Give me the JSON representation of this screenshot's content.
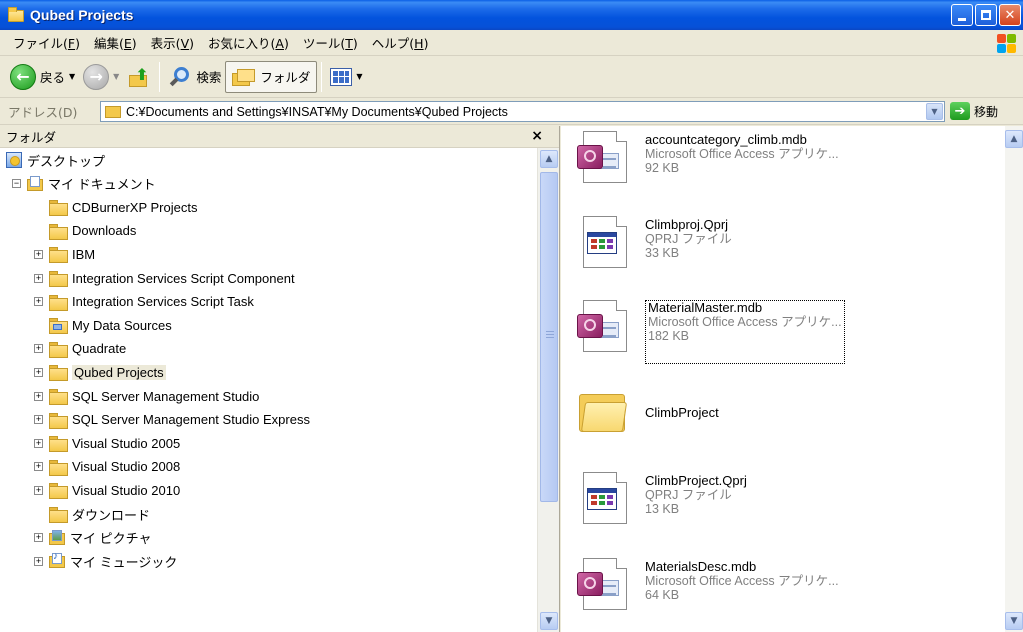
{
  "window": {
    "title": "Qubed Projects"
  },
  "menu": [
    {
      "text": "ファイル(",
      "key": "F",
      "end": ")"
    },
    {
      "text": "編集(",
      "key": "E",
      "end": ")"
    },
    {
      "text": "表示(",
      "key": "V",
      "end": ")"
    },
    {
      "text": "お気に入り(",
      "key": "A",
      "end": ")"
    },
    {
      "text": "ツール(",
      "key": "T",
      "end": ")"
    },
    {
      "text": "ヘルプ(",
      "key": "H",
      "end": ")"
    }
  ],
  "toolbar": {
    "back": "戻る",
    "search": "検索",
    "folders": "フォルダ"
  },
  "address": {
    "label": "アドレス(D)",
    "path": "C:¥Documents and Settings¥INSAT¥My Documents¥Qubed Projects",
    "go": "移動"
  },
  "folder_pane": {
    "title": "フォルダ",
    "close": "×",
    "tree": [
      {
        "label": "デスクトップ",
        "icon": "desktop-icon",
        "level": 0,
        "expander": ""
      },
      {
        "label": "マイ ドキュメント",
        "icon": "my-documents-icon",
        "level": 1,
        "expander": "−"
      },
      {
        "label": "CDBurnerXP Projects",
        "icon": "folder-icon",
        "level": 2,
        "expander": ""
      },
      {
        "label": "Downloads",
        "icon": "folder-icon",
        "level": 2,
        "expander": ""
      },
      {
        "label": "IBM",
        "icon": "folder-icon",
        "level": 2,
        "expander": "+"
      },
      {
        "label": "Integration Services Script Component",
        "icon": "folder-icon",
        "level": 2,
        "expander": "+"
      },
      {
        "label": "Integration Services Script Task",
        "icon": "folder-icon",
        "level": 2,
        "expander": "+"
      },
      {
        "label": "My Data Sources",
        "icon": "data-sources-icon",
        "level": 2,
        "expander": ""
      },
      {
        "label": "Quadrate",
        "icon": "folder-icon",
        "level": 2,
        "expander": "+"
      },
      {
        "label": "Qubed Projects",
        "icon": "folder-icon",
        "level": 2,
        "expander": "+",
        "selected": true
      },
      {
        "label": "SQL Server Management Studio",
        "icon": "folder-icon",
        "level": 2,
        "expander": "+"
      },
      {
        "label": "SQL Server Management Studio Express",
        "icon": "folder-icon",
        "level": 2,
        "expander": "+"
      },
      {
        "label": "Visual Studio 2005",
        "icon": "folder-icon",
        "level": 2,
        "expander": "+"
      },
      {
        "label": "Visual Studio 2008",
        "icon": "folder-icon",
        "level": 2,
        "expander": "+"
      },
      {
        "label": "Visual Studio 2010",
        "icon": "folder-icon",
        "level": 2,
        "expander": "+"
      },
      {
        "label": "ダウンロード",
        "icon": "folder-icon",
        "level": 2,
        "expander": ""
      },
      {
        "label": "マイ ピクチャ",
        "icon": "my-pictures-icon",
        "level": 2,
        "expander": "+"
      },
      {
        "label": "マイ ミュージック",
        "icon": "my-music-icon",
        "level": 2,
        "expander": "+"
      }
    ]
  },
  "files": [
    {
      "name": "accountcategory_climb.mdb",
      "type": "Microsoft Office Access アプリケ...",
      "size": "92 KB",
      "icon": "access-db-icon"
    },
    {
      "name": "Climbproj.Qprj",
      "type": "QPRJ ファイル",
      "size": "33 KB",
      "icon": "qprj-file-icon"
    },
    {
      "name": "MaterialMaster.mdb",
      "type": "Microsoft Office Access アプリケ...",
      "size": "182 KB",
      "icon": "access-db-icon",
      "focused": true
    },
    {
      "name": "ClimbProject",
      "type": "",
      "size": "",
      "icon": "folder-icon"
    },
    {
      "name": "ClimbProject.Qprj",
      "type": "QPRJ ファイル",
      "size": "13 KB",
      "icon": "qprj-file-icon"
    },
    {
      "name": "MaterialsDesc.mdb",
      "type": "Microsoft Office Access アプリケ...",
      "size": "64 KB",
      "icon": "access-db-icon"
    }
  ]
}
